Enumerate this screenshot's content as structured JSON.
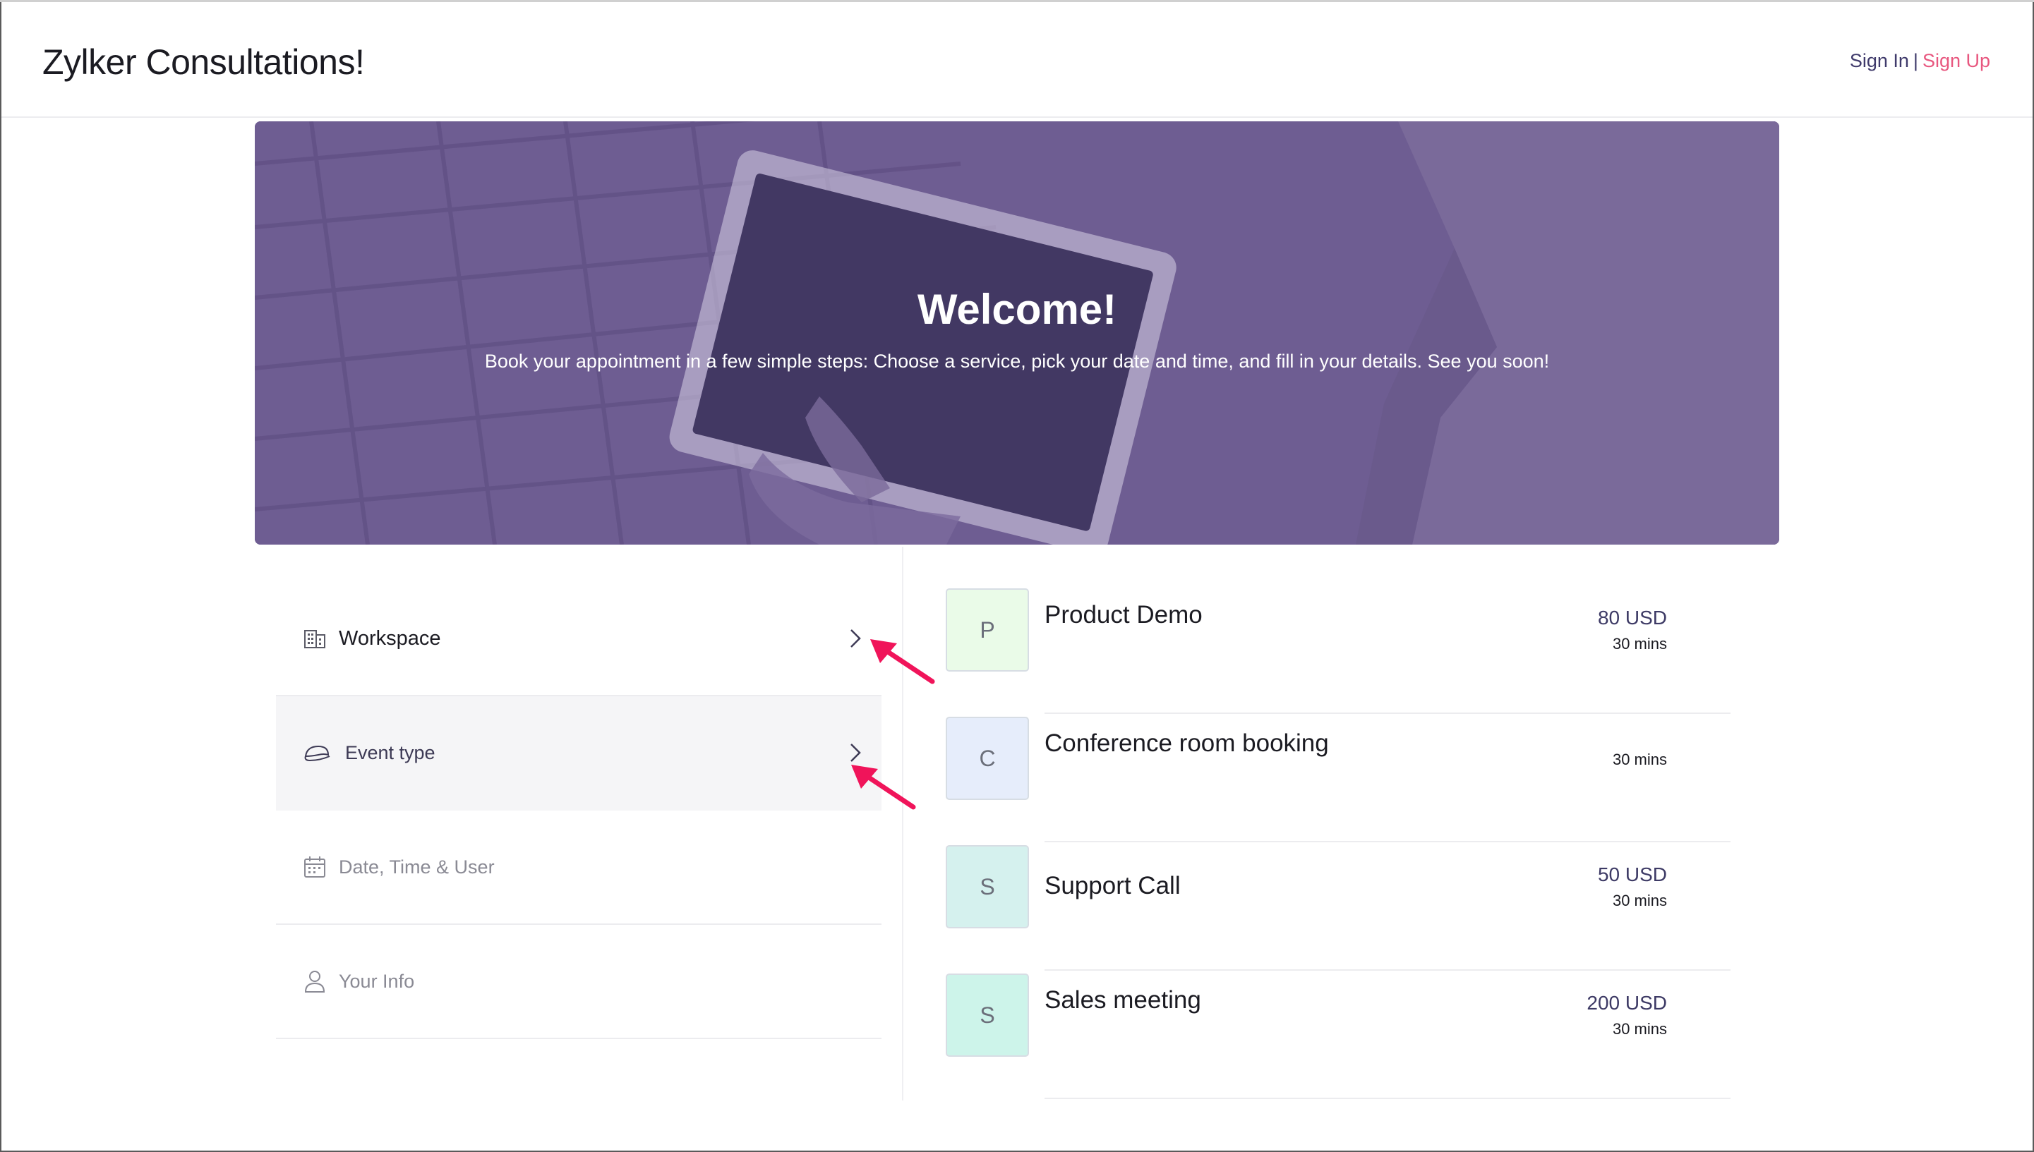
{
  "header": {
    "title": "Zylker Consultations!",
    "sign_in": "Sign In",
    "separator": "|",
    "sign_up": "Sign Up"
  },
  "hero": {
    "title": "Welcome!",
    "subtitle": "Book your appointment in a few simple steps: Choose a service, pick your date and time, and fill in your details. See you soon!"
  },
  "steps": [
    {
      "label": "Workspace",
      "icon": "building-icon"
    },
    {
      "label": "Event type",
      "icon": "cap-icon"
    },
    {
      "label": "Date, Time & User",
      "icon": "calendar-icon"
    },
    {
      "label": "Your Info",
      "icon": "user-icon"
    }
  ],
  "services": [
    {
      "initial": "P",
      "name": "Product Demo",
      "price": "80 USD",
      "duration": "30 mins",
      "color": "#eafbe8"
    },
    {
      "initial": "C",
      "name": "Conference room booking",
      "price": "",
      "duration": "30 mins",
      "color": "#e6edfb"
    },
    {
      "initial": "S",
      "name": "Support Call",
      "price": "50 USD",
      "duration": "30 mins",
      "color": "#d5f1ee"
    },
    {
      "initial": "S",
      "name": "Sales meeting",
      "price": "200 USD",
      "duration": "30 mins",
      "color": "#cdf4ea"
    }
  ],
  "colors": {
    "accent": "#e8577f",
    "hero_overlay": "#6b5a8f",
    "annotation_arrow": "#f0145a"
  }
}
